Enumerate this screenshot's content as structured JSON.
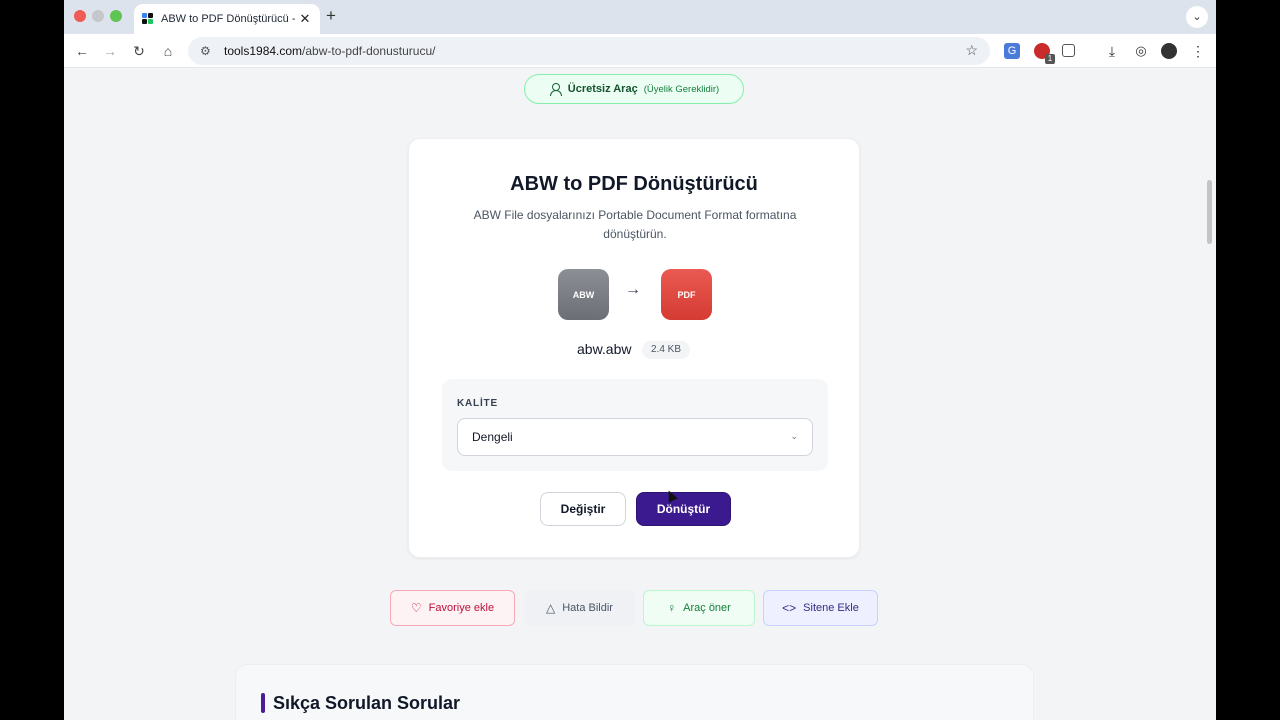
{
  "browser": {
    "tab_title": "ABW to PDF Dönüştürücü - Ü",
    "tab_close": "✕",
    "new_tab": "+",
    "tab_menu": "⌄",
    "url_host": "tools1984.com",
    "url_path": "/abw-to-pdf-donusturucu/",
    "extension_badge": "1",
    "colors": {
      "traffic_red": "#ee5c55",
      "traffic_gray": "#c5c7cc",
      "traffic_green": "#5fc454"
    }
  },
  "badge": {
    "label": "Ücretsiz Araç",
    "sub": "(Üyelik Gereklidir)",
    "icon": "user-icon"
  },
  "converter": {
    "title": "ABW to PDF Dönüştürücü",
    "description": "ABW File dosyalarınızı Portable Document Format formatına dönüştürün.",
    "source_format": "ABW",
    "target_format": "PDF",
    "file_name": "abw.abw",
    "file_size": "2.4 KB",
    "quality_label": "KALİTE",
    "quality_value": "Dengeli",
    "change_button": "Değiştir",
    "convert_button": "Dönüştür",
    "colors": {
      "convert": "#3b1a8f",
      "pdf": "#d9413a",
      "abw": "#7a7c83"
    }
  },
  "actions": {
    "favorite": "Favoriye ekle",
    "report": "Hata Bildir",
    "suggest": "Araç öner",
    "embed": "Sitene Ekle"
  },
  "faq": {
    "title": "Sıkça Sorulan Sorular"
  }
}
